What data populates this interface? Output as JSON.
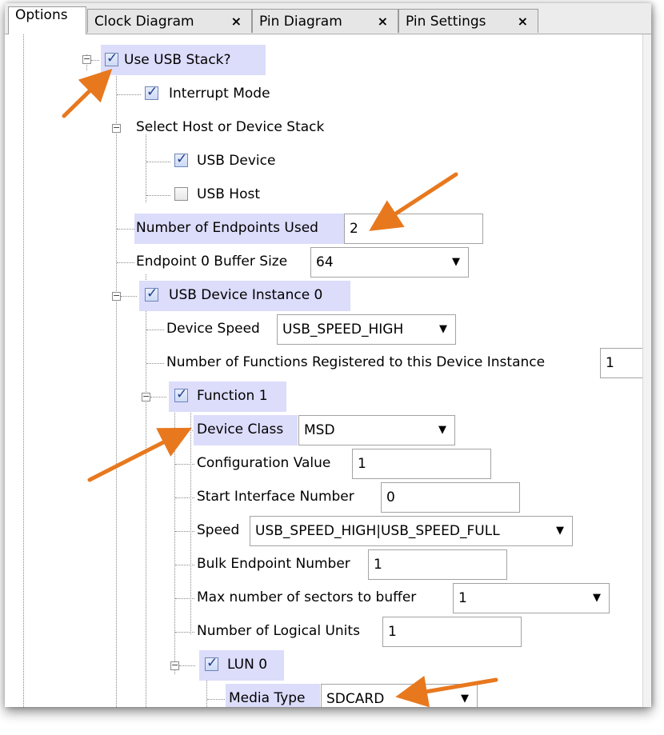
{
  "tabs": [
    {
      "label": "Options",
      "closable": false,
      "active": true
    },
    {
      "label": "Clock Diagram",
      "closable": true
    },
    {
      "label": "Pin Diagram",
      "closable": true
    },
    {
      "label": "Pin Settings",
      "closable": true
    }
  ],
  "tab_close_glyph": "×",
  "tree": {
    "use_usb_stack": {
      "label": "Use USB Stack?",
      "checked": true
    },
    "interrupt_mode": {
      "label": "Interrupt Mode",
      "checked": true
    },
    "select_stack": {
      "label": "Select Host or Device Stack"
    },
    "usb_device": {
      "label": "USB Device",
      "checked": true
    },
    "usb_host": {
      "label": "USB Host",
      "checked": false
    },
    "num_endpoints": {
      "label": "Number of Endpoints Used",
      "value": "2"
    },
    "ep0_buffer": {
      "label": "Endpoint 0 Buffer Size",
      "value": "64"
    },
    "device_instance": {
      "label": "USB Device Instance 0",
      "checked": true
    },
    "device_speed": {
      "label": "Device Speed",
      "value": "USB_SPEED_HIGH"
    },
    "num_functions": {
      "label": "Number of Functions Registered to this Device Instance",
      "value": "1"
    },
    "function1": {
      "label": "Function 1",
      "checked": true
    },
    "device_class": {
      "label": "Device Class",
      "value": "MSD"
    },
    "config_value": {
      "label": "Configuration Value",
      "value": "1"
    },
    "start_interface": {
      "label": "Start Interface Number",
      "value": "0"
    },
    "speed": {
      "label": "Speed",
      "value": "USB_SPEED_HIGH|USB_SPEED_FULL"
    },
    "bulk_endpoint": {
      "label": "Bulk Endpoint Number",
      "value": "1"
    },
    "max_sectors": {
      "label": "Max number of sectors to buffer",
      "value": "1"
    },
    "num_lun": {
      "label": "Number of Logical Units",
      "value": "1"
    },
    "lun0": {
      "label": "LUN 0",
      "checked": true
    },
    "media_type": {
      "label": "Media Type",
      "value": "SDCARD"
    }
  },
  "glyphs": {
    "check": "✓",
    "caret": "▼",
    "expander": "−"
  },
  "colors": {
    "highlight": "#dcdcfb",
    "annotation_arrow": "#e8781e"
  }
}
